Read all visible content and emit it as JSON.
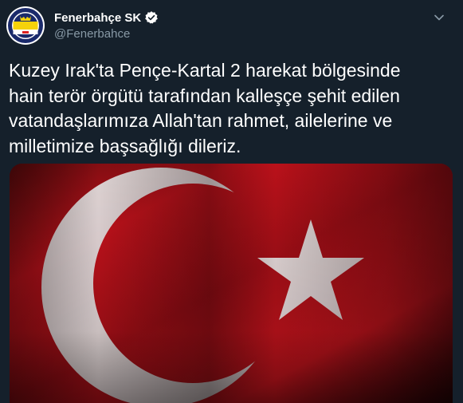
{
  "account": {
    "display_name": "Fenerbahçe SK",
    "handle": "@Fenerbahce",
    "verified": true,
    "avatar_icon": "fenerbahce-crest-icon",
    "verified_icon": "verified-badge-icon"
  },
  "tweet": {
    "text": "Kuzey Irak'ta Pençe-Kartal 2 harekat bölgesinde hain terör örgütü tarafından kalleşçe şehit edilen vatandaşlarımıza Allah'tan rahmet, ailelerine ve milletimize başsağlığı dileriz."
  },
  "media": {
    "description_icon": "turkish-flag-image",
    "colors": {
      "flag_red": "#b5101a",
      "flag_white": "#e8e8e8"
    }
  },
  "colors": {
    "background": "#15202b",
    "text_primary": "#ffffff",
    "text_secondary": "#8899a6",
    "verified_blue": "#ffffff"
  }
}
